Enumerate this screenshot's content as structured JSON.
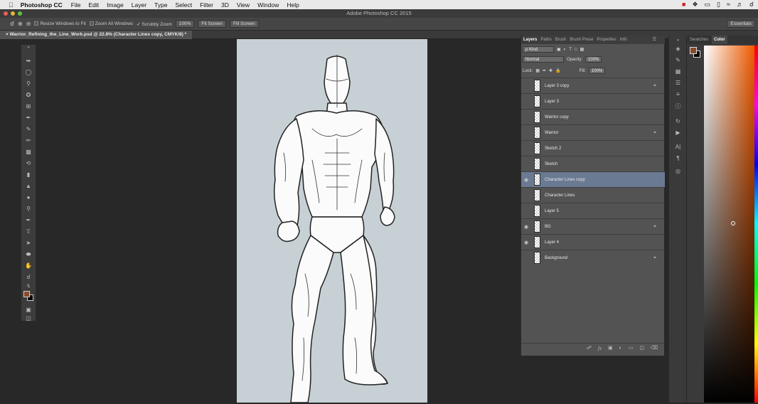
{
  "menubar": {
    "apple": "",
    "app": "Photoshop CC",
    "items": [
      "File",
      "Edit",
      "Image",
      "Layer",
      "Type",
      "Select",
      "Filter",
      "3D",
      "View",
      "Window",
      "Help"
    ]
  },
  "window": {
    "title": "Adobe Photoshop CC 2015"
  },
  "options": {
    "resize_label": "Resize Windows to Fit",
    "zoom_all_label": "Zoom All Windows",
    "scrubby_label": "Scrubby Zoom",
    "zoom_value": "100%",
    "fit_screen": "Fit Screen",
    "fill_screen": "Fill Screen",
    "workspace": "Essentials"
  },
  "document": {
    "tab_title": "Warrior_Refining_the_Line_Work.psd @ 22.8% (Character Lines copy, CMYK/8) *"
  },
  "layers_panel": {
    "tabs": [
      "Layers",
      "Paths",
      "Brush",
      "Brush Prese",
      "Properties",
      "Info"
    ],
    "active_tab": "Layers",
    "filter_label": "ρ Kind",
    "blend_mode": "Normal",
    "opacity_label": "Opacity:",
    "opacity_value": "100%",
    "lock_label": "Lock:",
    "fill_label": "Fill:",
    "fill_value": "100%",
    "layers": [
      {
        "name": "Layer 3 copy",
        "visible": false,
        "locked": true,
        "selected": false
      },
      {
        "name": "Layer 3",
        "visible": false,
        "locked": false,
        "selected": false
      },
      {
        "name": "Warrior copy",
        "visible": false,
        "locked": false,
        "selected": false
      },
      {
        "name": "Warrior",
        "visible": false,
        "locked": true,
        "selected": false
      },
      {
        "name": "Sketch 2",
        "visible": false,
        "locked": false,
        "selected": false
      },
      {
        "name": "Sketch",
        "visible": false,
        "locked": false,
        "selected": false
      },
      {
        "name": "Character Lines copy",
        "visible": true,
        "locked": false,
        "selected": true
      },
      {
        "name": "Character Lines",
        "visible": false,
        "locked": false,
        "selected": false
      },
      {
        "name": "Layer 5",
        "visible": false,
        "locked": false,
        "selected": false
      },
      {
        "name": "BG",
        "visible": true,
        "locked": true,
        "selected": false
      },
      {
        "name": "Layer 4",
        "visible": true,
        "locked": false,
        "selected": false
      },
      {
        "name": "Background",
        "visible": false,
        "locked": true,
        "selected": false
      }
    ]
  },
  "color_panel": {
    "tabs": [
      "Swatches",
      "Color"
    ],
    "active_tab": "Color",
    "foreground": "#8a4a2a",
    "background": "#000000"
  },
  "colors": {
    "canvas_bg": "#c7d0d4",
    "selected_layer": "#6b7a93"
  }
}
